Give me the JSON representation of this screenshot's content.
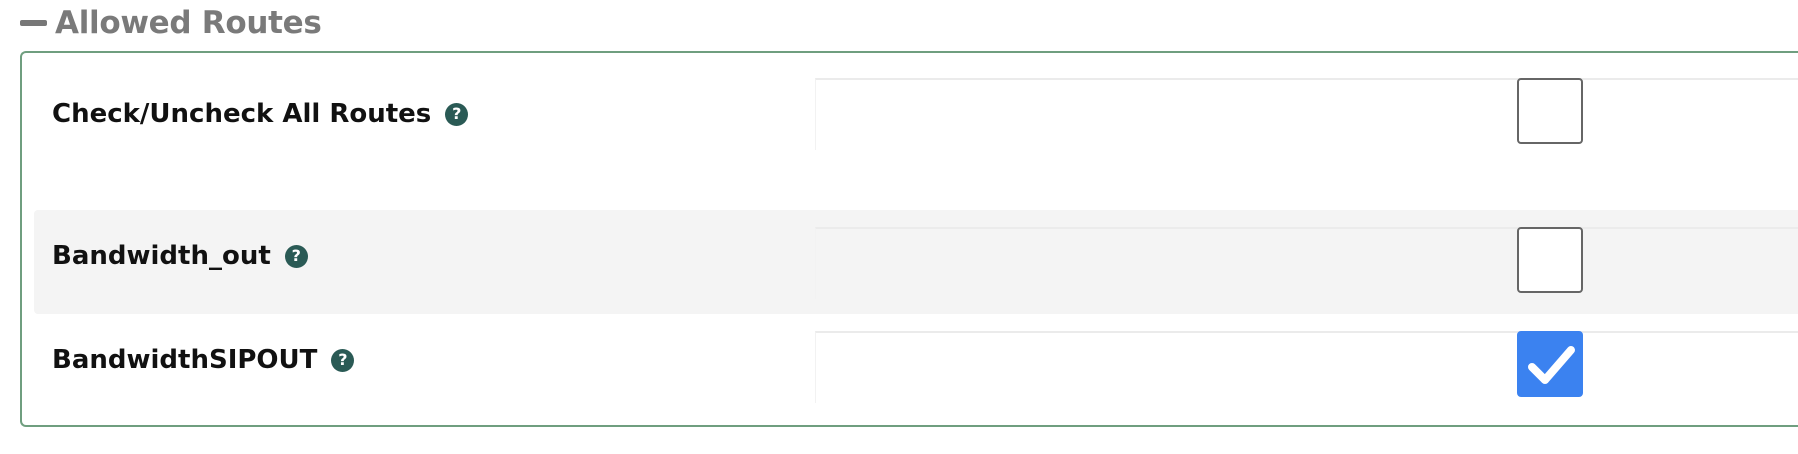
{
  "section": {
    "title": "Allowed Routes",
    "collapse_icon": "minus-icon"
  },
  "rows": [
    {
      "label": "Check/Uncheck All Routes",
      "help_icon": "question-icon",
      "checked": false
    },
    {
      "label": "Bandwidth_out",
      "help_icon": "question-icon",
      "checked": false
    },
    {
      "label": "BandwidthSIPOUT",
      "help_icon": "question-icon",
      "checked": true
    }
  ],
  "help_glyph": "?",
  "colors": {
    "panel_border": "#6f9e7f",
    "help_icon_bg": "#2a5a55",
    "checkbox_checked": "#3b82f0",
    "header_text": "#7a7a7a"
  }
}
